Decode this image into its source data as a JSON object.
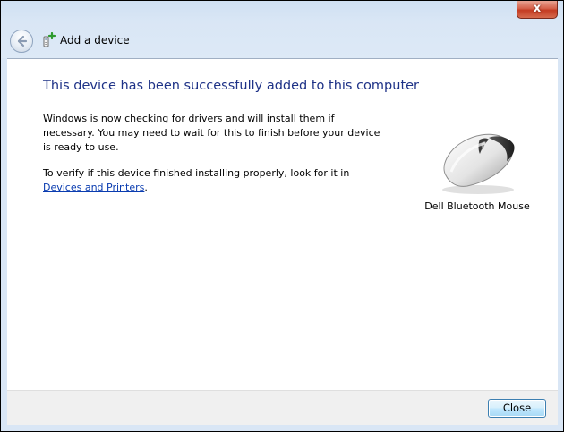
{
  "window": {
    "close_glyph": "x",
    "colors": {
      "frame": "#d9e6f5",
      "heading": "#1e3287",
      "link": "#0a3cb0",
      "close_button_accent": "#3c7fb1"
    }
  },
  "header": {
    "title": "Add a device",
    "back_icon": "back-arrow-icon",
    "title_icon": "add-device-icon"
  },
  "main": {
    "heading": "This device has been successfully added to this computer",
    "paragraph1": "Windows is now checking for drivers and will install them if necessary. You may need to wait for this to finish before your device is ready to use.",
    "paragraph2_text": "To verify if this device finished installing properly, look for it in",
    "paragraph2_link": "Devices and Printers",
    "paragraph2_tail": ".",
    "device": {
      "name": "Dell Bluetooth Mouse",
      "icon": "mouse-icon"
    }
  },
  "footer": {
    "close_label": "Close"
  }
}
